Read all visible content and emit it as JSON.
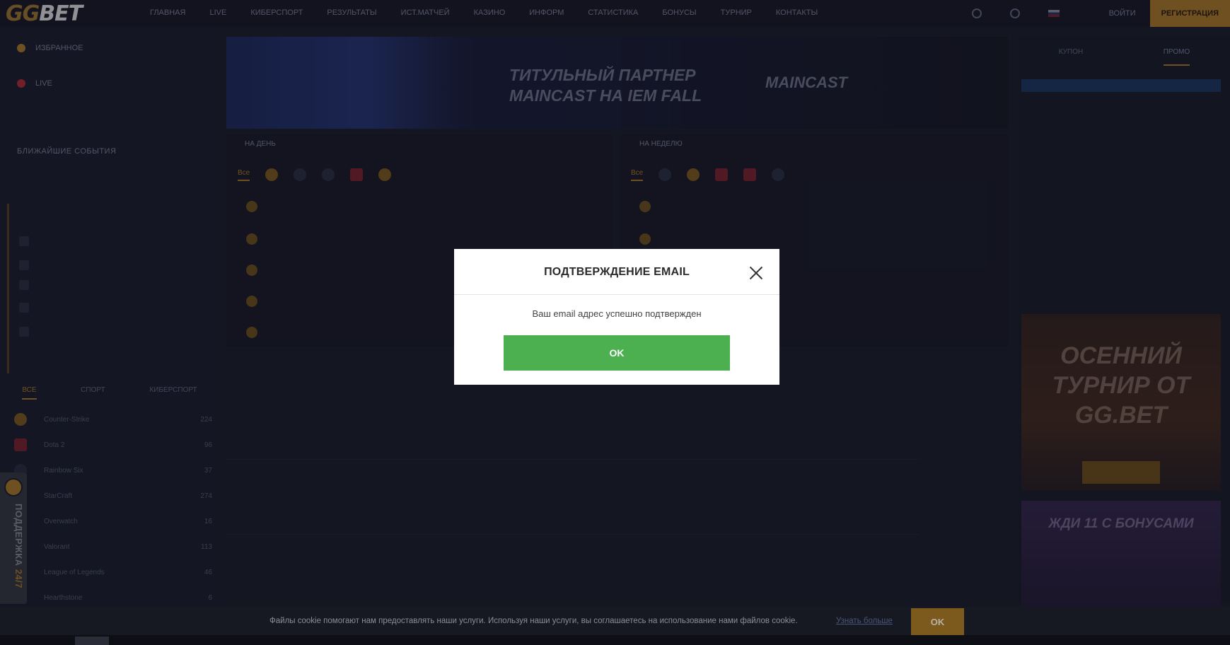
{
  "header": {
    "logo_gg": "GG",
    "logo_bet": "BET",
    "nav": [
      "ГЛАВНАЯ",
      "LIVE",
      "КИБЕРСПОРТ",
      "РЕЗУЛЬТАТЫ",
      "ИСТ.МАТЧЕЙ",
      "КАЗИНО",
      "ИНФОРМ",
      "СТАТИСТИКА",
      "БОНУСЫ",
      "ТУРНИР",
      "КОНТАКТЫ"
    ],
    "login": "ВОЙТИ",
    "register": "РЕГИСТРАЦИЯ"
  },
  "sidebar": {
    "favorites_label": "ИЗБРАННОЕ",
    "live_label": "LIVE",
    "nearest_events": "БЛИЖАЙШИЕ СОБЫТИЯ",
    "tabs": [
      "ВСЕ",
      "СПОРТ",
      "КИБЕРСПОРТ"
    ],
    "sports": [
      {
        "name": "Counter-Strike",
        "count": "224"
      },
      {
        "name": "Dota 2",
        "count": "96"
      },
      {
        "name": "Rainbow Six",
        "count": "37"
      },
      {
        "name": "StarCraft",
        "count": "274"
      },
      {
        "name": "Overwatch",
        "count": "16"
      },
      {
        "name": "Valorant",
        "count": "113"
      },
      {
        "name": "League of Legends",
        "count": "46"
      },
      {
        "name": "Hearthstone",
        "count": "6"
      }
    ]
  },
  "support": {
    "label": "ПОДДЕРЖКА",
    "hours": "24/7"
  },
  "banner": {
    "title": "ТИТУЛЬНЫЙ ПАРТНЕР MAINCAST НА IEM FALL",
    "logo": "MAINCAST"
  },
  "panels": {
    "day": "НА ДЕНЬ",
    "week": "НА НЕДЕЛЮ"
  },
  "right": {
    "tabs": [
      "КУПОН",
      "ПРОМО"
    ],
    "promo1": "ОСЕННИЙ ТУРНИР ОТ GG.BET",
    "promo2": "ЖДИ 11 С БОНУСАМИ"
  },
  "modal": {
    "title": "ПОДТВЕРЖДЕНИЕ EMAIL",
    "message": "Ваш email адрес успешно подтвержден",
    "ok_label": "OK"
  },
  "cookie": {
    "text": "Файлы cookie помогают нам предоставлять наши услуги. Используя наши услуги, вы соглашаетесь на использование нами файлов cookie.",
    "link": "Узнать больше",
    "ok_label": "OK"
  },
  "colors": {
    "accent": "#c28a2c",
    "modal_button": "#4caf50",
    "background": "#1c1f2e"
  }
}
